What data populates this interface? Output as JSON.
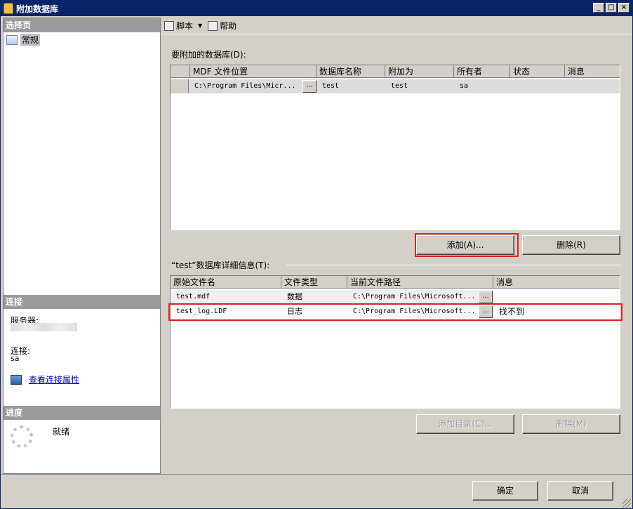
{
  "window": {
    "title": "附加数据库"
  },
  "left": {
    "select_page_header": "选择页",
    "pages": [
      {
        "label": "常规"
      }
    ],
    "connection_header": "连接",
    "server_label": "服务器:",
    "connection_label": "连接:",
    "connection_value": "sa",
    "view_props_link": "查看连接属性",
    "progress_header": "进度",
    "progress_status": "就绪"
  },
  "toolbar": {
    "script_label": "脚本",
    "help_label": "帮助"
  },
  "attach": {
    "label": "要附加的数据库(D):",
    "columns": [
      "MDF 文件位置",
      "数据库名称",
      "附加为",
      "所有者",
      "状态",
      "消息"
    ],
    "rows": [
      {
        "mdf": "C:\\Program Files\\Micr...",
        "ellipsis": "...",
        "db_name": "test",
        "attach_as": "test",
        "owner": "sa",
        "status": "",
        "message": ""
      }
    ],
    "add_button": "添加(A)...",
    "remove_button": "删除(R)"
  },
  "details": {
    "label": "“test”数据库详细信息(T):",
    "columns": [
      "原始文件名",
      "文件类型",
      "当前文件路径",
      "消息"
    ],
    "rows": [
      {
        "file": "test.mdf",
        "type": "数据",
        "path": "C:\\Program Files\\Microsoft...",
        "ellipsis": "...",
        "message": ""
      },
      {
        "file": "test_log.LDF",
        "type": "日志",
        "path": "C:\\Program Files\\Microsoft...",
        "ellipsis": "...",
        "message": "找不到"
      }
    ],
    "add_catalog_button": "添加目录(C)...",
    "remove_button": "删除(M)"
  },
  "footer": {
    "ok_button": "确定",
    "cancel_button": "取消"
  },
  "colors": {
    "highlight": "#e02020",
    "title_bar": "#0a246a",
    "section_header": "#9a9a9a"
  }
}
